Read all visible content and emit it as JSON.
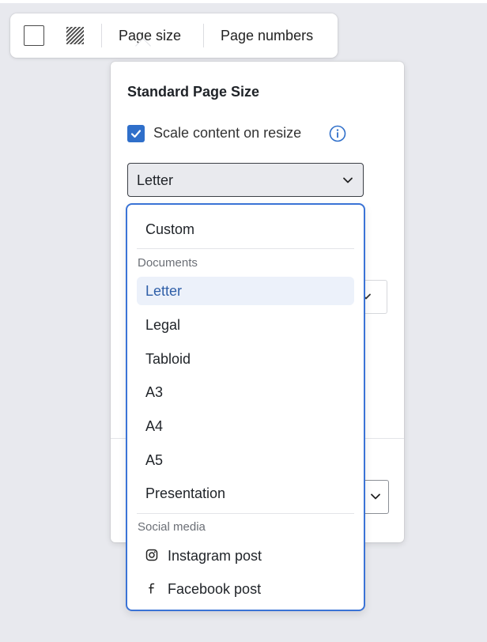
{
  "toolbar": {
    "page_size_label": "Page size",
    "page_numbers_label": "Page numbers"
  },
  "panel": {
    "title": "Standard Page Size",
    "scale_checkbox": {
      "label": "Scale content on resize",
      "checked": true
    },
    "select_value": "Letter"
  },
  "dropdown": {
    "custom_label": "Custom",
    "documents_group": "Documents",
    "documents": [
      "Letter",
      "Legal",
      "Tabloid",
      "A3",
      "A4",
      "A5",
      "Presentation"
    ],
    "selected": "Letter",
    "social_group": "Social media",
    "social": [
      {
        "label": "Instagram post",
        "icon": "instagram-icon"
      },
      {
        "label": "Facebook post",
        "icon": "facebook-icon"
      }
    ]
  },
  "colors": {
    "accent": "#3a73d6",
    "checkbox": "#2f6fca",
    "selected_bg": "#ecf1fa",
    "selected_text": "#2f5fa8",
    "backdrop": "#e8e9ee"
  }
}
